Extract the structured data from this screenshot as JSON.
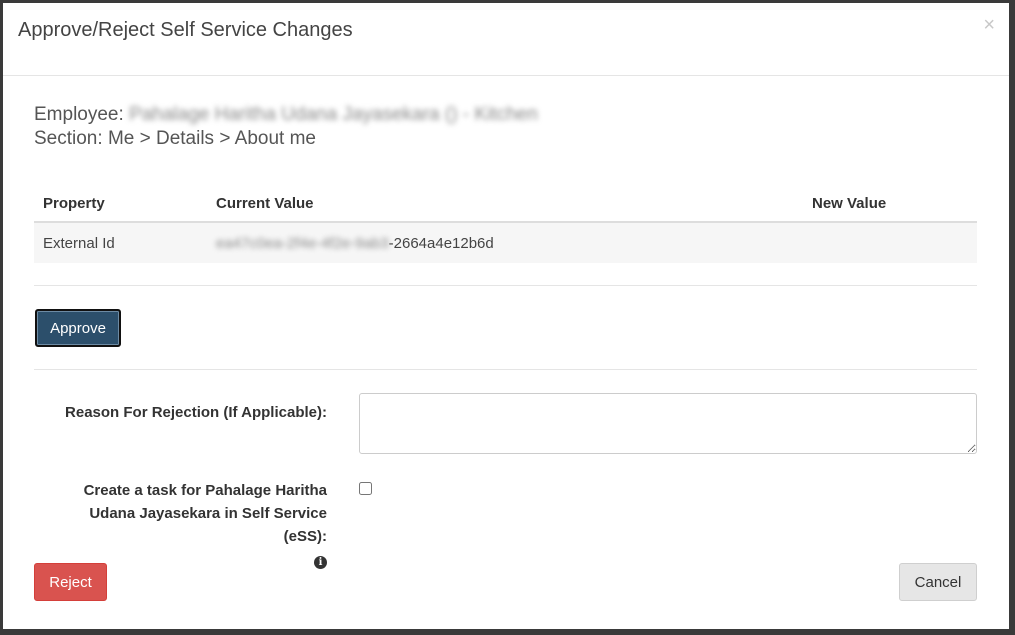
{
  "modal": {
    "title": "Approve/Reject Self Service Changes",
    "close_glyph": "×"
  },
  "meta": {
    "employee_label": "Employee:",
    "employee_value": "Pahalage Haritha Udana Jayasekara () - Kitchen",
    "section_label": "Section:",
    "section_value": "Me > Details > About me"
  },
  "table": {
    "headers": [
      "Property",
      "Current Value",
      "New Value"
    ],
    "rows": [
      {
        "property": "External Id",
        "current_value_redacted": "ea47c0ea-2f4e-4f2e-9ab3",
        "current_value_visible": "-2664a4e12b6d",
        "new_value": ""
      }
    ]
  },
  "actions": {
    "approve_label": "Approve",
    "reject_label": "Reject",
    "cancel_label": "Cancel"
  },
  "form": {
    "reason_label": "Reason For Rejection (If Applicable):",
    "reason_value": "",
    "task_label_line1": "Create a task for Pahalage Haritha",
    "task_label_line2": "Udana Jayasekara in Self Service (eSS):",
    "task_checked": false,
    "info_glyph": "i"
  },
  "colors": {
    "approve": "#2c4f6b",
    "reject": "#d9534f",
    "cancel": "#e6e6e6"
  }
}
